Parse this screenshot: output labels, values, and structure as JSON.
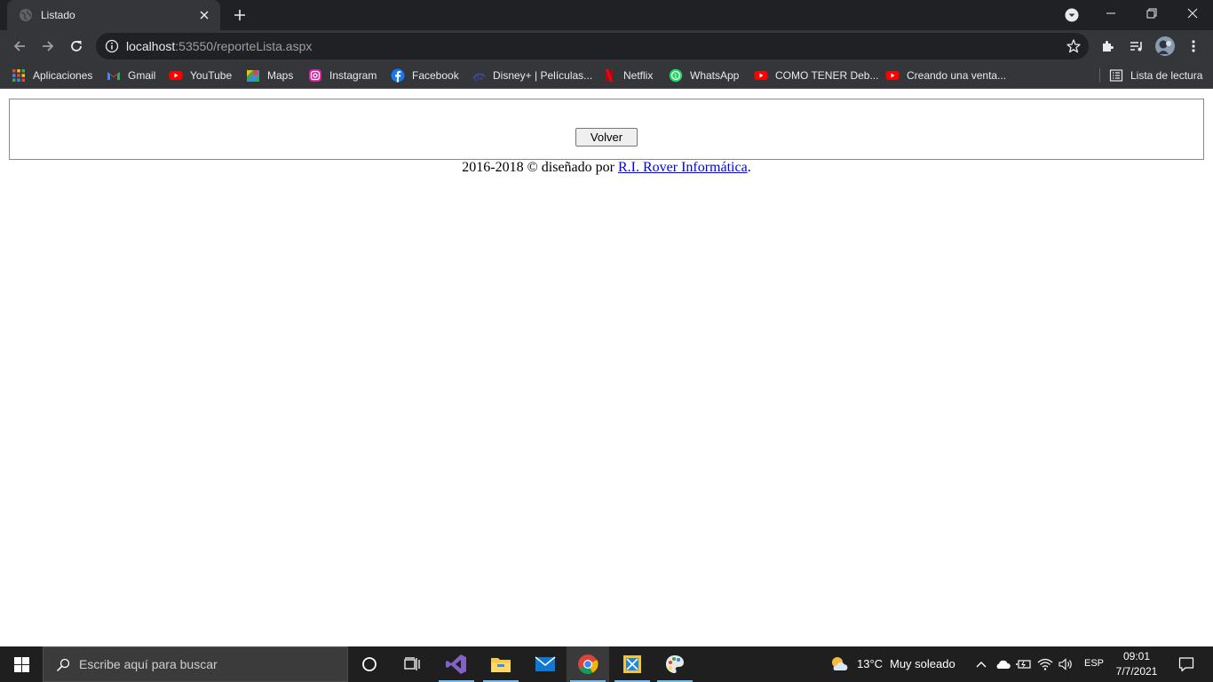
{
  "browser": {
    "tab": {
      "title": "Listado"
    },
    "address": {
      "host": "localhost",
      "rest": ":53550/reporteLista.aspx"
    },
    "bookmarks": [
      {
        "label": "Aplicaciones",
        "icon": "apps-grid-icon"
      },
      {
        "label": "Gmail",
        "icon": "gmail-icon"
      },
      {
        "label": "YouTube",
        "icon": "youtube-icon"
      },
      {
        "label": "Maps",
        "icon": "maps-icon"
      },
      {
        "label": "Instagram",
        "icon": "instagram-icon"
      },
      {
        "label": "Facebook",
        "icon": "facebook-icon"
      },
      {
        "label": "Disney+ | Películas...",
        "icon": "disney-icon"
      },
      {
        "label": "Netflix",
        "icon": "netflix-icon"
      },
      {
        "label": "WhatsApp",
        "icon": "whatsapp-icon"
      },
      {
        "label": "COMO TENER Deb...",
        "icon": "youtube-icon"
      },
      {
        "label": "Creando una venta...",
        "icon": "youtube-icon"
      }
    ],
    "reading_list": "Lista de lectura"
  },
  "page": {
    "button_label": "Volver",
    "footer": {
      "prefix": "2016-2018 © diseñado por ",
      "link": "R.I. Rover Informática",
      "suffix": "."
    }
  },
  "taskbar": {
    "search_placeholder": "Escribe aquí para buscar",
    "weather": {
      "temp": "13°C",
      "desc": "Muy soleado"
    },
    "language": "ESP",
    "time": "09:01",
    "date": "7/7/2021"
  },
  "colors": {
    "chrome_dark": "#202124",
    "chrome_toolbar": "#35363a",
    "link_blue": "#0000ee",
    "taskbar": "#1f1f1f",
    "taskbar_accent": "#76b9ed"
  }
}
